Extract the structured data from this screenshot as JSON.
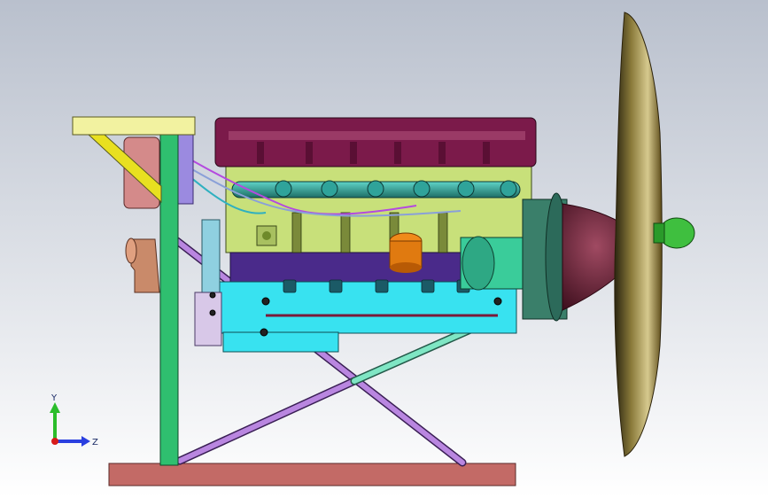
{
  "viewport": {
    "background_top": "#b9c0cd",
    "background_bottom": "#ffffff"
  },
  "triad": {
    "y_label": "Y",
    "z_label": "Z",
    "y_color": "#2bbd2b",
    "z_color": "#2a3fe0",
    "x_color": "#d81b1b"
  },
  "model": {
    "description_icon": "engine-assembly-icon",
    "colors": {
      "base_plate": "#c36a66",
      "frame_post": "#2fbf6f",
      "top_bracket": "#f2f2a0",
      "engine_block": "#c8e07a",
      "valve_cover": "#7b1a4a",
      "oil_pan": "#38e2f0",
      "crankcase": "#4a2a8a",
      "strut_violet": "#b986e0",
      "strut_mint": "#7fe6c4",
      "propeller_blade": "#6b5a22",
      "hub": "#6e2438",
      "spinner_tip": "#3fbf3f",
      "intake_pipes": "#2fa39a",
      "rear_gear": "#3a7f6a",
      "elbow_pipe": "#c98a6a",
      "oil_cap": "#f08a1a"
    }
  }
}
